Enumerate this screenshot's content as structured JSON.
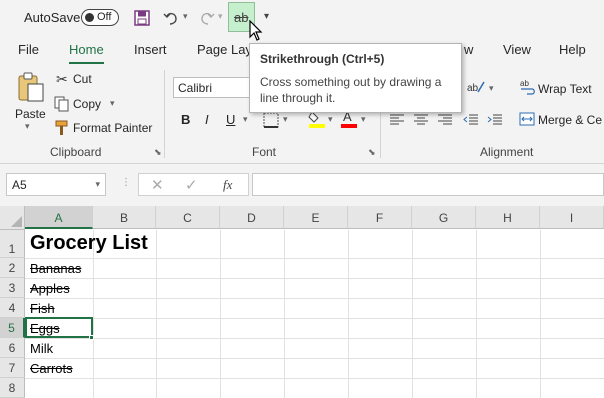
{
  "qat": {
    "autosave_label": "AutoSave",
    "autosave_state": "Off",
    "strikethrough_label": "ab"
  },
  "tabs": [
    "File",
    "Home",
    "Insert",
    "Page Layout",
    "w",
    "View",
    "Help"
  ],
  "active_tab": "Home",
  "ribbon": {
    "clipboard": {
      "paste": "Paste",
      "cut": "Cut",
      "copy": "Copy",
      "format_painter": "Format Painter",
      "group_label": "Clipboard"
    },
    "font": {
      "font_name": "Calibri",
      "bold": "B",
      "italic": "I",
      "underline": "U",
      "group_label": "Font"
    },
    "alignment": {
      "wrap_text": "Wrap Text",
      "merge": "Merge & Ce",
      "group_label": "Alignment"
    }
  },
  "tooltip": {
    "title": "Strikethrough (Ctrl+5)",
    "description": "Cross something out by drawing a line through it."
  },
  "formula_bar": {
    "name_box": "A5",
    "fx": "fx",
    "content": ""
  },
  "sheet": {
    "columns": [
      "A",
      "B",
      "C",
      "D",
      "E",
      "F",
      "G",
      "H",
      "I"
    ],
    "rows": [
      "1",
      "2",
      "3",
      "4",
      "5",
      "6",
      "7",
      "8"
    ],
    "title": "Grocery List",
    "items": [
      {
        "text": "Bananas",
        "strike": true
      },
      {
        "text": "Apples",
        "strike": true
      },
      {
        "text": "Fish",
        "strike": true
      },
      {
        "text": "Eggs",
        "strike": true
      },
      {
        "text": "Milk",
        "strike": false
      },
      {
        "text": "Carrots",
        "strike": true
      }
    ],
    "active_cell": "A5"
  },
  "colors": {
    "accent": "#217346",
    "strike_button_bg": "#c6efce",
    "highlight_yellow": "#ffff00",
    "font_red": "#ff0000"
  }
}
